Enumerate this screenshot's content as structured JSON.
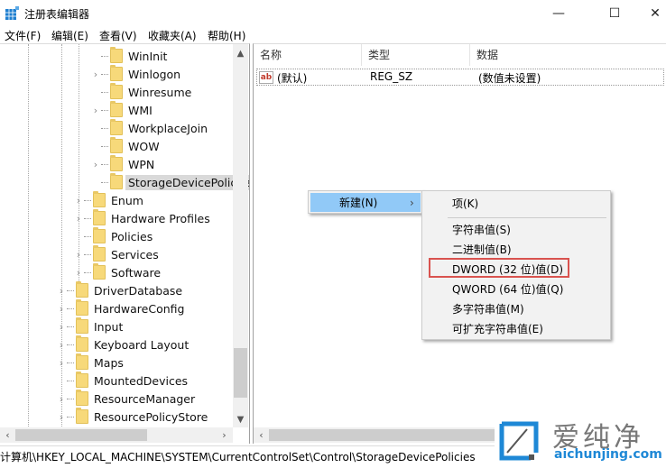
{
  "window": {
    "title": "注册表编辑器",
    "icon": "registry-editor-icon",
    "controls": {
      "minimize": "—",
      "maximize": "☐",
      "close": "✕"
    }
  },
  "menubar": {
    "items": [
      {
        "label": "文件(F)"
      },
      {
        "label": "编辑(E)"
      },
      {
        "label": "查看(V)"
      },
      {
        "label": "收藏夹(A)"
      },
      {
        "label": "帮助(H)"
      }
    ]
  },
  "tree": {
    "items": [
      {
        "label": "WinInit",
        "expandable": false,
        "level": 3
      },
      {
        "label": "Winlogon",
        "expandable": true,
        "level": 3
      },
      {
        "label": "Winresume",
        "expandable": false,
        "level": 3
      },
      {
        "label": "WMI",
        "expandable": true,
        "level": 3
      },
      {
        "label": "WorkplaceJoin",
        "expandable": false,
        "level": 3
      },
      {
        "label": "WOW",
        "expandable": false,
        "level": 3
      },
      {
        "label": "WPN",
        "expandable": true,
        "level": 3
      },
      {
        "label": "StorageDevicePolicies",
        "expandable": false,
        "level": 3,
        "selected": true
      },
      {
        "label": "Enum",
        "expandable": true,
        "level": 2
      },
      {
        "label": "Hardware Profiles",
        "expandable": true,
        "level": 2
      },
      {
        "label": "Policies",
        "expandable": false,
        "level": 2
      },
      {
        "label": "Services",
        "expandable": true,
        "level": 2
      },
      {
        "label": "Software",
        "expandable": true,
        "level": 2
      },
      {
        "label": "DriverDatabase",
        "expandable": true,
        "level": 1
      },
      {
        "label": "HardwareConfig",
        "expandable": true,
        "level": 1
      },
      {
        "label": "Input",
        "expandable": true,
        "level": 1
      },
      {
        "label": "Keyboard Layout",
        "expandable": true,
        "level": 1
      },
      {
        "label": "Maps",
        "expandable": true,
        "level": 1
      },
      {
        "label": "MountedDevices",
        "expandable": false,
        "level": 1
      },
      {
        "label": "ResourceManager",
        "expandable": true,
        "level": 1
      },
      {
        "label": "ResourcePolicyStore",
        "expandable": true,
        "level": 1
      }
    ]
  },
  "list": {
    "columns": [
      "名称",
      "类型",
      "数据"
    ],
    "rows": [
      {
        "icon": "ab",
        "name": "(默认)",
        "type": "REG_SZ",
        "data": "(数值未设置)"
      }
    ]
  },
  "context_menu": {
    "parent_item": {
      "label": "新建(N)",
      "arrow": "›"
    },
    "submenu": [
      {
        "label": "项(K)"
      },
      {
        "label": "字符串值(S)"
      },
      {
        "label": "二进制值(B)"
      },
      {
        "label": "DWORD (32 位)值(D)",
        "highlighted": true
      },
      {
        "label": "QWORD (64 位)值(Q)"
      },
      {
        "label": "多字符串值(M)"
      },
      {
        "label": "可扩充字符串值(E)"
      }
    ]
  },
  "statusbar": {
    "path": "计算机\\HKEY_LOCAL_MACHINE\\SYSTEM\\CurrentControlSet\\Control\\StorageDevicePolicies"
  },
  "watermark": {
    "brand_cn": "爱纯净",
    "brand_url": "aichunjing.com",
    "color": "#1e88d6"
  },
  "colors": {
    "menu_hover": "#91c9f7",
    "highlight_box": "#d9534f",
    "folder": "#f7d97a"
  }
}
